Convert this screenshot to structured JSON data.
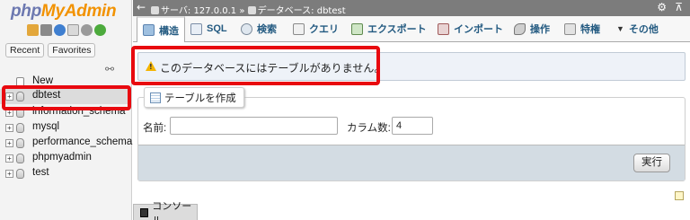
{
  "nav": {
    "logo_php": "php",
    "logo_admin": "MyAdmin",
    "tabs": [
      "Recent",
      "Favorites"
    ],
    "tree": [
      {
        "label": "New"
      },
      {
        "label": "dbtest"
      },
      {
        "label": "information_schema"
      },
      {
        "label": "mysql"
      },
      {
        "label": "performance_schema"
      },
      {
        "label": "phpmyadmin"
      },
      {
        "label": "test"
      }
    ]
  },
  "topbar": {
    "server": "サーバ: 127.0.0.1",
    "separator": "»",
    "database": "データベース: dbtest"
  },
  "tabs": [
    {
      "label": "構造",
      "icon": "structure-icon"
    },
    {
      "label": "SQL",
      "icon": "sql-icon"
    },
    {
      "label": "検索",
      "icon": "search-icon"
    },
    {
      "label": "クエリ",
      "icon": "query-icon"
    },
    {
      "label": "エクスポート",
      "icon": "export-icon"
    },
    {
      "label": "インポート",
      "icon": "import-icon"
    },
    {
      "label": "操作",
      "icon": "wrench-icon"
    },
    {
      "label": "特権",
      "icon": "privileges-icon"
    },
    {
      "label": "その他",
      "icon": "chevron-down-icon"
    }
  ],
  "message": {
    "text": "このデータベースにはテーブルがありません。"
  },
  "create_table": {
    "legend": "テーブルを作成",
    "name_label": "名前:",
    "name_value": "",
    "columns_label": "カラム数:",
    "columns_value": "4",
    "go_label": "実行"
  },
  "console": {
    "label": "コンソール"
  },
  "colors": {
    "highlight": "#e8090f",
    "topbar": "#7c7c7c",
    "tab_text": "#235a81",
    "footer": "#d3dce3"
  }
}
